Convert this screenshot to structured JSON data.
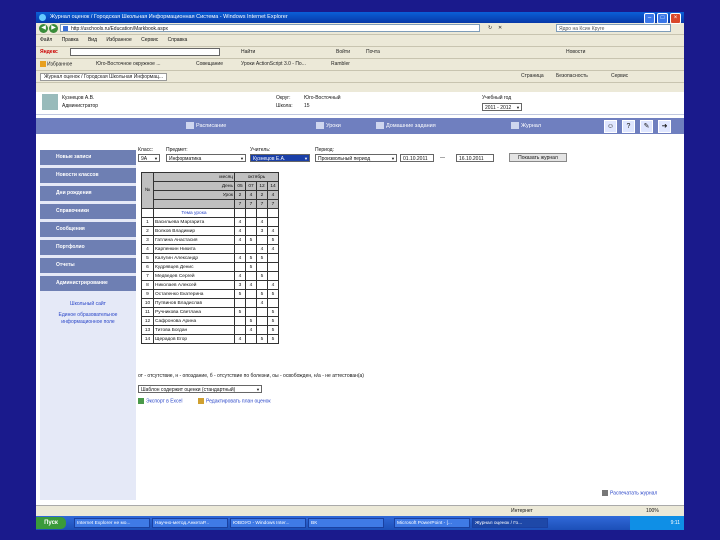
{
  "window": {
    "title": "Журнал оценок / Городская Школьная Информационная Система - Windows Internet Explorer"
  },
  "address": {
    "url": "http://uschools.ru/Education/Markbook.aspx"
  },
  "search": {
    "placeholder": "Ядро на Ксин Круге"
  },
  "menu": [
    "Файл",
    "Правка",
    "Вид",
    "Избранное",
    "Сервис",
    "Справка"
  ],
  "toolbar": {
    "yandex": "Яндекс",
    "find": "Найти",
    "ru": "Войти",
    "mail": "Почта",
    "news": "Новости"
  },
  "favorites": {
    "label": "Избранное",
    "items": [
      "Юго-Восточное окружное ...",
      "Совещание",
      "Уроки ActionScript 3.0 - По...",
      "Rambler"
    ]
  },
  "ie_tab": {
    "label": "Журнал оценок / Городская Школьная Информац..."
  },
  "ie_commands": [
    "Страница",
    "Безопасность",
    "Сервис"
  ],
  "user": {
    "name": "Кузнецов А.В.",
    "role": "Администратор"
  },
  "school_info": {
    "district_label": "Округ:",
    "district": "Юго-Восточный",
    "school_label": "Школа:",
    "school": "15",
    "year_label": "Учебный год",
    "year": "2011 - 2012"
  },
  "nav": [
    "Расписание",
    "Уроки",
    "Домашние задания",
    "Журнал"
  ],
  "sidebar": {
    "items": [
      "Новые записи",
      "Новости классов",
      "Дни рождения",
      "Справочники",
      "Сообщения",
      "Портфолио",
      "Отчеты",
      "Администрирование"
    ],
    "links": [
      "Школьный сайт",
      "Единое образовательное информационное поле"
    ]
  },
  "filters": {
    "class_label": "Класс:",
    "class_value": "9А",
    "subject_label": "Предмет:",
    "subject_value": "Информатика",
    "teacher_label": "Учитель:",
    "teacher_value": "Кузнецов Е.А.",
    "period_label": "Период:",
    "period_value": "Произвольный период",
    "date_from": "01.10.2011",
    "dash": "—",
    "date_to": "16.10.2011",
    "show_button": "Показать журнал"
  },
  "journal": {
    "month_label": "месяц",
    "month": "октябрь",
    "num_header": "№",
    "day_label": "День",
    "days": [
      "05",
      "07",
      "12",
      "14"
    ],
    "lesson_label": "Урок",
    "lessons": [
      "2",
      "4",
      "2",
      "4"
    ],
    "lesson_numbers": [
      "7",
      "7",
      "7",
      "7"
    ],
    "topic_label": "Тема урока",
    "students": [
      {
        "n": "1",
        "name": "Васильева Маргарита",
        "marks": [
          "4",
          "",
          "4",
          ""
        ]
      },
      {
        "n": "2",
        "name": "Волков Владимир",
        "marks": [
          "4",
          "",
          "3",
          "4"
        ]
      },
      {
        "n": "3",
        "name": "Гатлина Анастасия",
        "marks": [
          "4",
          "5",
          "",
          "5"
        ]
      },
      {
        "n": "4",
        "name": "Карпенкин Никита",
        "marks": [
          "",
          "",
          "4",
          "4"
        ]
      },
      {
        "n": "5",
        "name": "Калугин Александр",
        "marks": [
          "4",
          "5",
          "5",
          ""
        ]
      },
      {
        "n": "6",
        "name": "Кудрявцев Денис",
        "marks": [
          "",
          "5",
          "",
          ""
        ]
      },
      {
        "n": "7",
        "name": "Медведев Сергей",
        "marks": [
          "4",
          "",
          "5",
          ""
        ]
      },
      {
        "n": "8",
        "name": "Николаев Алексей",
        "marks": [
          "3",
          "4",
          "",
          "4"
        ]
      },
      {
        "n": "9",
        "name": "Остапенко Екатерина",
        "marks": [
          "5",
          "",
          "5",
          "5"
        ]
      },
      {
        "n": "10",
        "name": "Путвинов Владислав",
        "marks": [
          "",
          "",
          "4",
          ""
        ]
      },
      {
        "n": "11",
        "name": "Ручникова Светлана",
        "marks": [
          "5",
          "",
          "",
          "5"
        ]
      },
      {
        "n": "12",
        "name": "Сафронова Арина",
        "marks": [
          "",
          "5",
          "",
          "5"
        ]
      },
      {
        "n": "13",
        "name": "Титова Богдан",
        "marks": [
          "",
          "4",
          "",
          "5"
        ]
      },
      {
        "n": "14",
        "name": "Щерадов Егор",
        "marks": [
          "4",
          "",
          "5",
          "5"
        ]
      }
    ]
  },
  "legend": "от - отсутствие, н - опоздание, б - отсутствие по болезни, оы - освобожден, н/а - не аттестован(а)",
  "template_select": "Шаблон содержит оценки (стандартный)",
  "actions": {
    "export": "Экспорт в Excel",
    "edit": "Редактировать план оценок"
  },
  "print_link": "Распечатать журнал",
  "status": {
    "zone": "Интернет",
    "zoom": "100%"
  },
  "taskbar": {
    "start": "Пуск",
    "tasks": [
      "Internet Explorer не мо...",
      "Научно-метод.АнкетаР...",
      "ЮВОУО - Windows Inter...",
      "ВК",
      "Microsoft PowerPoint - [...",
      "Журнал оценок / Го..."
    ],
    "clock": "9:11"
  },
  "colors": {
    "desktop": "#1a1a8c",
    "nav_bar": "#6f7fbf",
    "sidebar_item": "#6e7fb3",
    "link": "#2a46c8"
  }
}
